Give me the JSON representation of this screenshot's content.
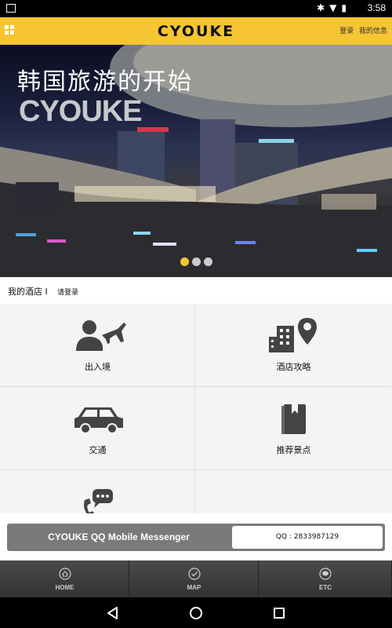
{
  "status": {
    "time": "3:58"
  },
  "header": {
    "logo": "CYOUKE",
    "login": "登录",
    "my_info": "我的信息"
  },
  "banner": {
    "title": "韩国旅游的开始",
    "subtitle": "CYOUKE",
    "slides": 3,
    "active_slide": 1
  },
  "my_hotel": {
    "label": "我的酒店 I",
    "login_prompt": "请登录"
  },
  "menu": [
    {
      "label": "出入境",
      "icon": "person-plane-icon"
    },
    {
      "label": "酒店攻略",
      "icon": "hotel-location-icon"
    },
    {
      "label": "交通",
      "icon": "car-icon"
    },
    {
      "label": "推荐景点",
      "icon": "guidebook-icon"
    },
    {
      "label": "",
      "icon": "phone-chat-icon"
    },
    {
      "label": "",
      "icon": ""
    }
  ],
  "messenger": {
    "title": "CYOUKE QQ Mobile Messenger",
    "qq": "QQ : 2833987129"
  },
  "tabs": [
    {
      "label": "HOME",
      "icon": "home-icon"
    },
    {
      "label": "MAP",
      "icon": "check-circle-icon"
    },
    {
      "label": "ETC",
      "icon": "chat-icon"
    }
  ],
  "colors": {
    "accent": "#f5c532",
    "tabbar": "#333333",
    "messenger": "#7a7a7a"
  }
}
